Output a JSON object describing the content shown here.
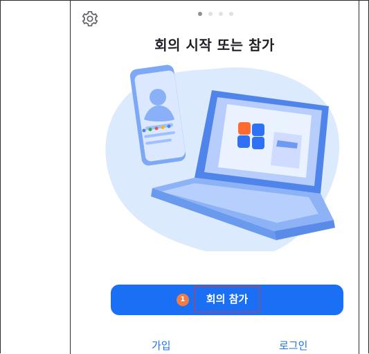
{
  "screen": {
    "title": "회의 시작 또는 참가",
    "pager": {
      "count": 4,
      "active_index": 0
    }
  },
  "actions": {
    "join_meeting": {
      "label": "회의 참가",
      "step_number": "1"
    },
    "sign_up": {
      "label": "가입"
    },
    "sign_in": {
      "label": "로그인"
    }
  },
  "icons": {
    "settings": "gear-icon"
  },
  "colors": {
    "primary": "#1a6ff4",
    "highlight_border": "#d9363e",
    "step_badge": "#ef7d45",
    "illustration_bg": "#dceafd"
  }
}
